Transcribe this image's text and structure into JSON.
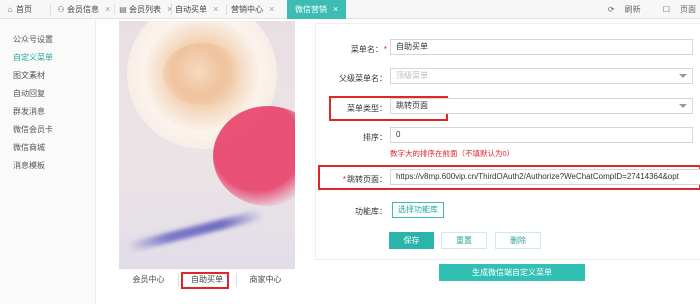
{
  "tabs": [
    {
      "label": "首页",
      "icon": "home-icon",
      "closable": false
    },
    {
      "label": "会员信息",
      "icon": "user-icon",
      "closable": true
    },
    {
      "label": "会员列表",
      "icon": "list-icon",
      "closable": true
    },
    {
      "label": "自动买单",
      "icon": "",
      "closable": true
    },
    {
      "label": "营销中心",
      "icon": "",
      "closable": true
    },
    {
      "label": "微信营销",
      "icon": "",
      "closable": true,
      "active": true
    }
  ],
  "actions": {
    "refresh": "刷新",
    "page": "页面"
  },
  "sidebar": {
    "items": [
      {
        "label": "公众号设置"
      },
      {
        "label": "自定义菜单",
        "active": true
      },
      {
        "label": "图文素材"
      },
      {
        "label": "自动回复"
      },
      {
        "label": "群发消息"
      },
      {
        "label": "微信会员卡"
      },
      {
        "label": "微信商城"
      },
      {
        "label": "消息模板"
      }
    ]
  },
  "preview_menu": {
    "items": [
      "会员中心",
      "自助买单",
      "商家中心"
    ],
    "highlighted_index": 1
  },
  "form": {
    "menu_name_label": "菜单名：",
    "menu_name_value": "自助买单",
    "parent_label": "父级菜单名：",
    "parent_value": "顶级菜单",
    "type_label": "菜单类型：",
    "type_value": "跳转页面",
    "sort_label": "排序：",
    "sort_value": "0",
    "sort_hint": "数字大的排序在前面（不填默认为0）",
    "url_label": "跳转页面：",
    "url_value": "https://v8mp.600vip.cn/ThirdOAuth2/Authorize?WeChatCompID=27414364&opt",
    "feature_label": "功能库：",
    "feature_button": "选择功能库",
    "save_button": "保存",
    "reset_button": "重置",
    "delete_button": "删除",
    "generate_button": "生成微信端自定义菜单"
  },
  "colors": {
    "accent": "#3cbcb3",
    "highlight": "#e0262b"
  }
}
